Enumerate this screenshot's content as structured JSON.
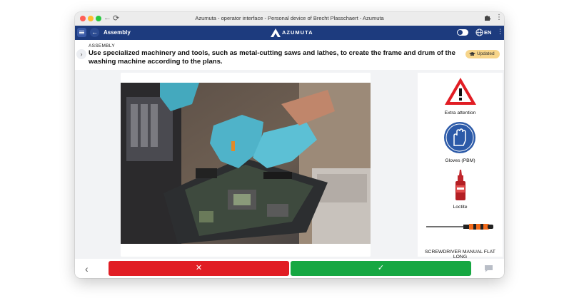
{
  "browser": {
    "window_title": "Azumuta - operator interface - Personal device of Brecht Plasschaert - Azumuta"
  },
  "appbar": {
    "title": "Assembly",
    "brand": "AZUMUTA",
    "language": "EN"
  },
  "step": {
    "label": "ASSEMBLY",
    "description": "Use specialized machinery and tools, such as metal-cutting saws and lathes, to create the frame and drum of the washing machine according to the plans.",
    "badge": "Updated"
  },
  "resources": [
    {
      "label": "Extra attention",
      "icon": "warning-icon"
    },
    {
      "label": "Gloves (PBM)",
      "icon": "gloves-icon"
    },
    {
      "label": "Loctite",
      "icon": "loctite-bottle-icon"
    },
    {
      "label": "SCREWDRIVER MANUAL FLAT LONG",
      "icon": "screwdriver-icon"
    }
  ],
  "colors": {
    "appbar": "#1d3b7e",
    "reject": "#e11d24",
    "accept": "#16a742",
    "badge": "#f7d58a"
  },
  "actions": {
    "reject_symbol": "✕",
    "accept_symbol": "✓",
    "prev_symbol": "‹"
  }
}
